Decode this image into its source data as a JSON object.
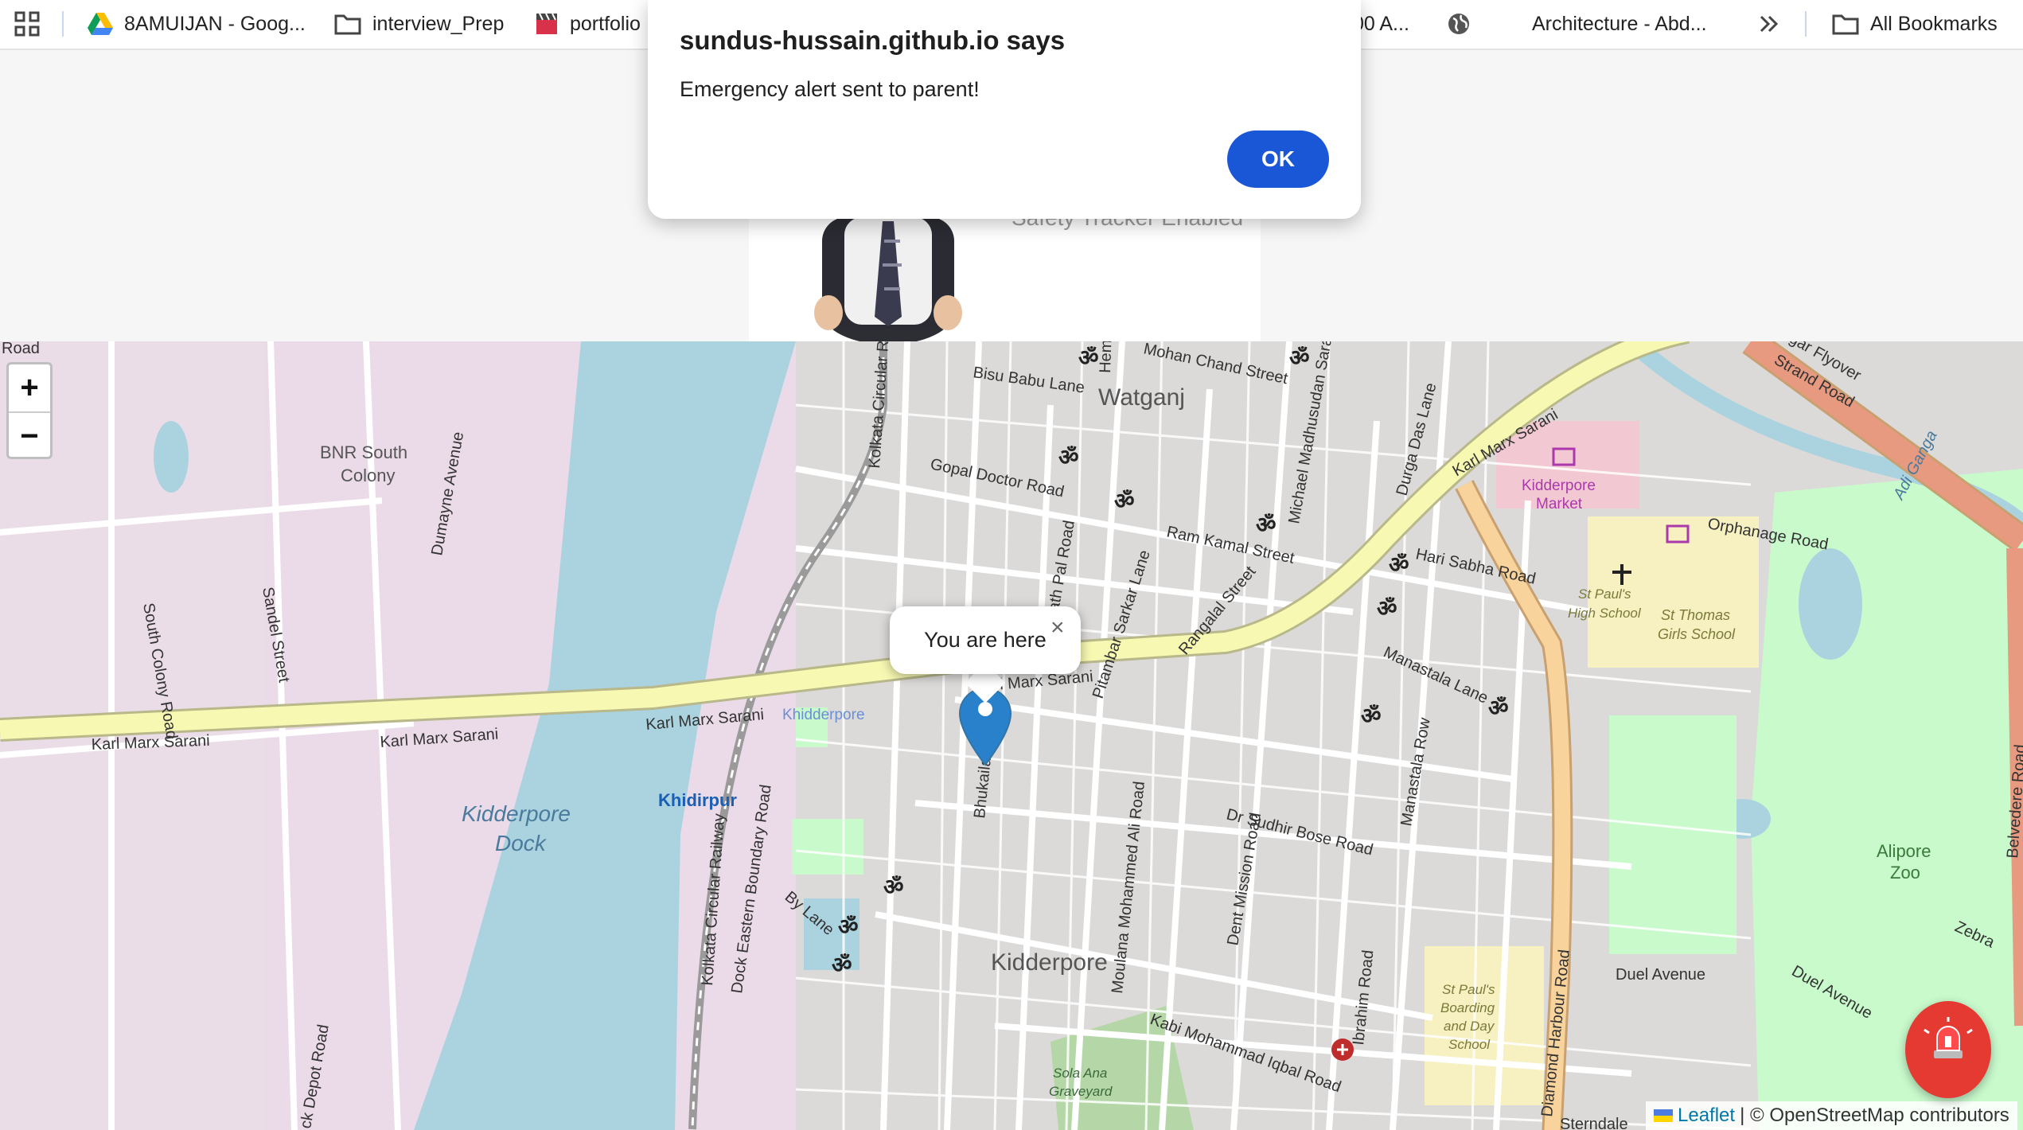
{
  "bookmarks": {
    "items": [
      {
        "label": "8AMUIJAN - Goog...",
        "icon": "google-drive-icon"
      },
      {
        "label": "interview_Prep",
        "icon": "folder-icon"
      },
      {
        "label": "portfolio",
        "icon": "clapperboard-icon"
      },
      {
        "label": "00 A...",
        "icon": "none"
      },
      {
        "label": "",
        "icon": "globe-icon"
      },
      {
        "label": "Architecture - Abd...",
        "icon": "none"
      },
      {
        "label": "All Bookmarks",
        "icon": "folder-icon"
      }
    ],
    "overflow_icon": "double-chevron-icon",
    "apps_icon": "apps-grid-icon"
  },
  "header": {
    "subtitle": "Safety Tracker Enabled"
  },
  "dialog": {
    "title": "sundus-hussain.github.io says",
    "message": "Emergency alert sent to parent!",
    "ok_label": "OK"
  },
  "map": {
    "zoom_in": "+",
    "zoom_out": "−",
    "popup_text": "You are here",
    "popup_close": "×",
    "attribution_link": "Leaflet",
    "attribution_text": "| © OpenStreetMap contributors",
    "labels": {
      "watganj": "Watganj",
      "kidderpore": "Kidderpore",
      "kidderpore_dock_1": "Kidderpore",
      "kidderpore_dock_2": "Dock",
      "khidirpur": "Khidirpur",
      "khidderpore_station": "Khidderpore",
      "bnr_1": "BNR South",
      "bnr_2": "Colony",
      "kidderpore_market_1": "Kidderpore",
      "kidderpore_market_2": "Market",
      "alipore_zoo_1": "Alipore",
      "alipore_zoo_2": "Zoo",
      "st_thomas_1": "St Thomas",
      "st_thomas_2": "Girls School",
      "st_pauls_high_1": "St Paul's",
      "st_pauls_high_2": "High School",
      "st_pauls_boarding_1": "St Paul's",
      "st_pauls_boarding_2": "Boarding",
      "st_pauls_boarding_3": "and Day",
      "st_pauls_boarding_4": "School",
      "graveyard_1": "Sola Ana",
      "graveyard_2": "Graveyard",
      "kms_1": "Karl Marx Sarani",
      "kms_2": "Karl Marx Sarani",
      "kms_3": "Karl Marx Sarani",
      "kms_4": "Karl Marx Sarani",
      "kms_5": "rl Marx Sarani",
      "bisu_babu": "Bisu Babu Lane",
      "mohan_chand": "Mohan Chand Street",
      "gopal_doctor": "Gopal Doctor Road",
      "ram_kamal": "Ram Kamal Street",
      "hari_sabha": "Hari Sabha Road",
      "orphanage": "Orphanage Road",
      "dr_sudhir": "Dr Sudhir Bose Road",
      "duel_avenue": "Duel Avenue",
      "duel_avenue_2": "Duel Avenue",
      "kabi_mohammad": "Kabi Mohammad Iqbal Road",
      "diamond_harbour": "Diamond Harbour Road",
      "dock_eastern": "Dock Eastern Boundary Road",
      "kolkata_circular": "Kolkata Circular Railway",
      "kolkata_circular_2": "Kolkata Circular R",
      "south_colony": "South Colony Road",
      "sandel": "Sandel Street",
      "dumayne": "Dumayne Avenue",
      "by_lane": "By Lane",
      "moulana": "Moulana Mohammed Ali Road",
      "dent_mission": "Dent Mission Road",
      "pitambar": "Pitambar Sarkar Lane",
      "rangalal": "Rangalal Street",
      "manastala": "Manastala Lane",
      "manastala_row": "Manastala Row",
      "michael": "Michael Madhusudan Sarani",
      "durga_das": "Durga Das Lane",
      "bhukailash": "Bhukailash",
      "ibrahim": "Ibrahim Road",
      "belvedere": "Belvedere Road",
      "strand": "Strand Road",
      "flyover": "gar Flyover",
      "adi_ganga": "Adi Ganga",
      "zebra": "Zebra",
      "dock_depot": "ck Depot Road",
      "sterndale": "Sterndale",
      "road_top_left": "Road",
      "hem": "Hem",
      "pal_road": "ath Pal Road"
    }
  },
  "colors": {
    "dialog_button": "#1a57d6",
    "sos_button": "#e53a32",
    "marker": "#2a81cb",
    "main_road": "#f7f8b2",
    "secondary_road": "#f8d39c",
    "water": "#aad3df",
    "industrial": "#ebdbe8",
    "park": "#c8facc"
  },
  "sos_icon": "siren-icon"
}
